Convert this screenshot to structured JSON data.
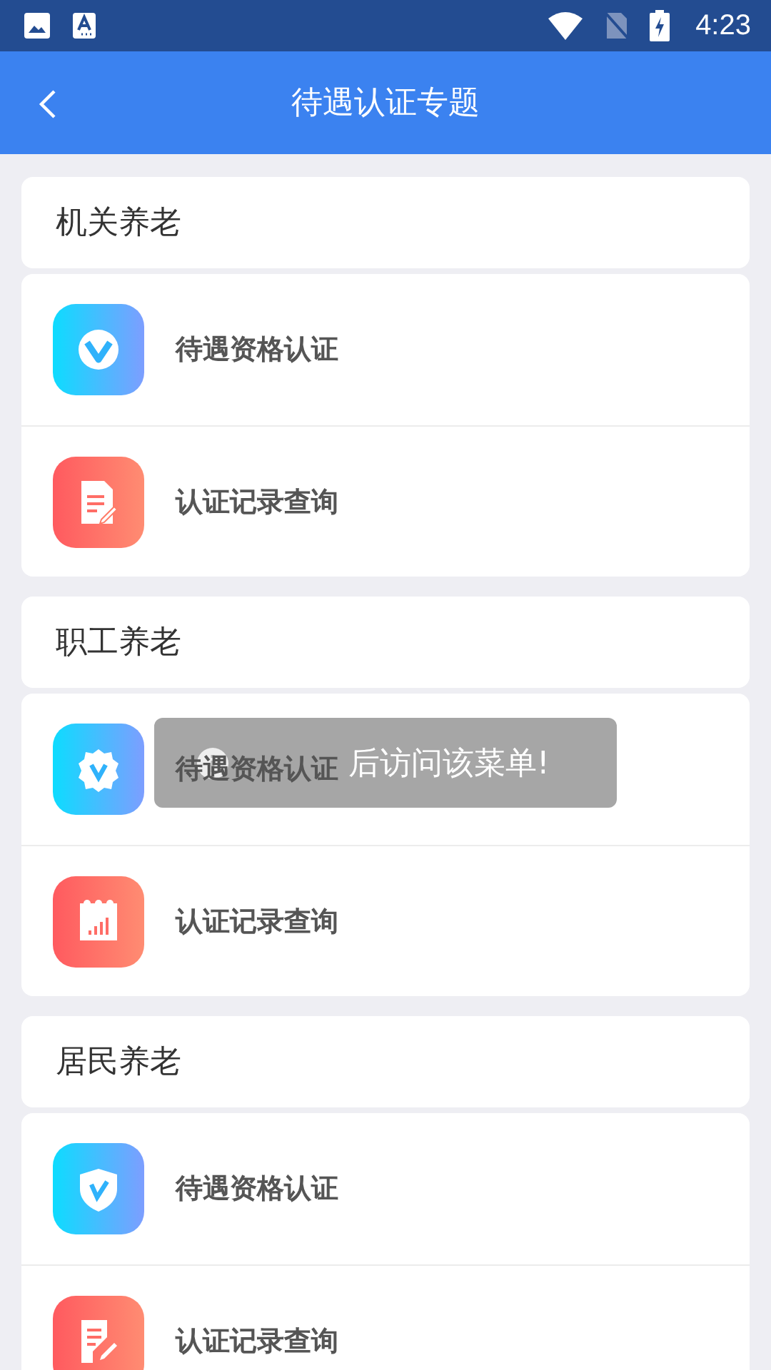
{
  "status_bar": {
    "time": "4:23"
  },
  "app_bar": {
    "title": "待遇认证专题"
  },
  "sections": [
    {
      "title": "机关养老",
      "items": [
        {
          "label": "待遇资格认证"
        },
        {
          "label": "认证记录查询"
        }
      ]
    },
    {
      "title": "职工养老",
      "items": [
        {
          "label": "待遇资格认证"
        },
        {
          "label": "认证记录查询"
        }
      ]
    },
    {
      "title": "居民养老",
      "items": [
        {
          "label": "待遇资格认证"
        },
        {
          "label": "认证记录查询"
        }
      ]
    }
  ],
  "toast": {
    "text": "后访问该菜单!"
  }
}
